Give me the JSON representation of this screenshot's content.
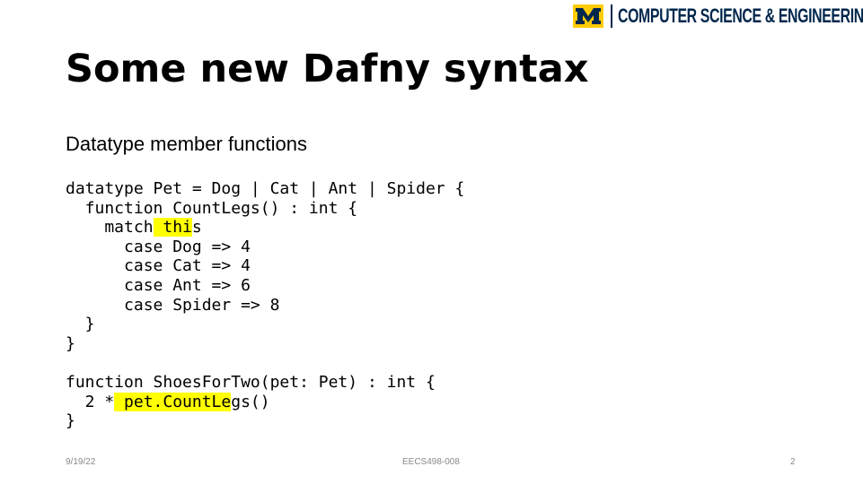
{
  "header": {
    "logo_text": "COMPUTER SCIENCE & ENGINEERING",
    "brand_colors": {
      "maize": "#ffcb05",
      "blue": "#00274c"
    }
  },
  "slide": {
    "title": "Some new Dafny syntax",
    "subtitle": "Datatype member functions",
    "highlight_color": "#ffff00",
    "code_lines": [
      {
        "pre": "datatype Pet = Dog | Cat | Ant | Spider {",
        "hl": "",
        "post": ""
      },
      {
        "pre": "  function CountLegs() : int {",
        "hl": "",
        "post": ""
      },
      {
        "pre": "    match",
        "hl": " thi",
        "post": "s"
      },
      {
        "pre": "      case Dog => 4",
        "hl": "",
        "post": ""
      },
      {
        "pre": "      case Cat => 4",
        "hl": "",
        "post": ""
      },
      {
        "pre": "      case Ant => 6",
        "hl": "",
        "post": ""
      },
      {
        "pre": "      case Spider => 8",
        "hl": "",
        "post": ""
      },
      {
        "pre": "  }",
        "hl": "",
        "post": ""
      },
      {
        "pre": "}",
        "hl": "",
        "post": ""
      },
      {
        "pre": "",
        "hl": "",
        "post": ""
      },
      {
        "pre": "function ShoesForTwo(pet: Pet) : int {",
        "hl": "",
        "post": ""
      },
      {
        "pre": "  2 *",
        "hl": " pet.CountLe",
        "post": "gs()"
      },
      {
        "pre": "}",
        "hl": "",
        "post": ""
      }
    ]
  },
  "footer": {
    "date": "9/19/22",
    "course": "EECS498-008",
    "page_number": "2"
  }
}
